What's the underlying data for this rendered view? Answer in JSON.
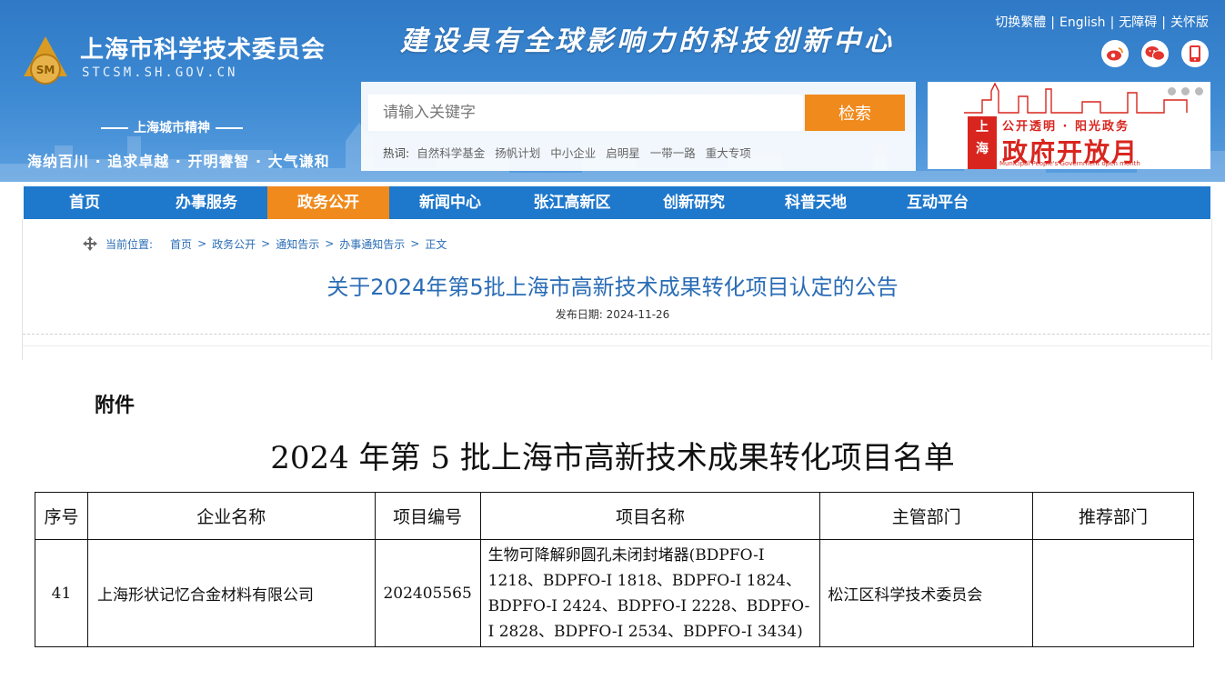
{
  "header": {
    "site_name": "上海市科学技术委员会",
    "site_domain": "STCSM.SH.GOV.CN",
    "logo_text": "SM",
    "slogan": "建设具有全球影响力的科技创新中心",
    "top_links": [
      "切换繁體",
      "English",
      "无障碍",
      "关怀版"
    ],
    "top_links_sep": "|",
    "social_icons": [
      "weibo-icon",
      "wechat-icon",
      "mobile-icon"
    ],
    "spirit_title": "上海城市精神",
    "spirit_text": "海纳百川 · 追求卓越 · 开明睿智 · 大气谦和"
  },
  "search": {
    "placeholder": "请输入关键字",
    "button_label": "检索",
    "hot_label": "热词:",
    "hot_words": [
      "自然科学基金",
      "扬帆计划",
      "中小企业",
      "启明星",
      "一带一路",
      "重大专项"
    ]
  },
  "banner": {
    "badge_top": "上",
    "badge_bottom": "海",
    "top_text": "公开透明 · 阳光政务",
    "main_text": "政府开放月",
    "sub_text": "Shanghai Municipal People's Government open month"
  },
  "nav": {
    "items": [
      "首页",
      "办事服务",
      "政务公开",
      "新闻中心",
      "张江高新区",
      "创新研究",
      "科普天地",
      "互动平台"
    ],
    "active_index": 2
  },
  "breadcrumb": {
    "label": "当前位置:",
    "items": [
      "首页",
      "政务公开",
      "通知告示",
      "办事通知告示",
      "正文"
    ],
    "sep": ">"
  },
  "article": {
    "title": "关于2024年第5批上海市高新技术成果转化项目认定的公告",
    "date_label": "发布日期:",
    "date": "2024-11-26"
  },
  "document": {
    "attachment_label": "附件",
    "title": "2024 年第 5 批上海市高新技术成果转化项目名单",
    "table": {
      "headers": [
        "序号",
        "企业名称",
        "项目编号",
        "项目名称",
        "主管部门",
        "推荐部门"
      ],
      "rows": [
        {
          "seq": "41",
          "company": "上海形状记忆合金材料有限公司",
          "code": "202405565",
          "project": "生物可降解卵圆孔未闭封堵器(BDPFO-I 1218、BDPFO-I 1818、BDPFO-I 1824、BDPFO-I 2424、BDPFO-I 2228、BDPFO-I 2828、BDPFO-I 2534、BDPFO-I 3434)",
          "dept": "松江区科学技术委员会",
          "recommender": ""
        }
      ]
    }
  },
  "colors": {
    "header_blue": "#3e8ad3",
    "nav_blue": "#1e78cc",
    "accent_orange": "#f08a1c",
    "title_blue": "#2a6cb5",
    "banner_red": "#d8261f"
  }
}
